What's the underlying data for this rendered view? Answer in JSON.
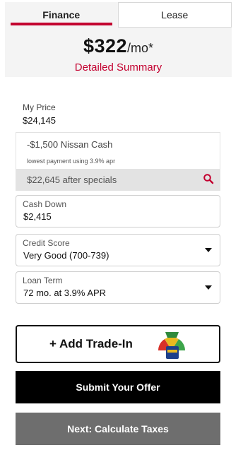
{
  "tabs": [
    {
      "label": "Finance",
      "active": true
    },
    {
      "label": "Lease",
      "active": false
    }
  ],
  "summary": {
    "payment_amount": "$322",
    "payment_unit": "/mo*",
    "link_label": "Detailed Summary"
  },
  "price": {
    "label": "My Price",
    "value": "$24,145"
  },
  "specials": {
    "name": "-$1,500 Nissan Cash",
    "note": "lowest payment using 3.9% apr",
    "after_text": "$22,645 after specials",
    "search_icon": "search-icon"
  },
  "fields": {
    "cash_down": {
      "label": "Cash Down",
      "value": "$2,415"
    },
    "credit_score": {
      "label": "Credit Score",
      "value": "Very Good (700-739)"
    },
    "loan_term": {
      "label": "Loan Term",
      "value": "72 mo. at 3.9% APR"
    }
  },
  "buttons": {
    "trade_in": "+ Add Trade-In",
    "submit": "Submit Your Offer",
    "next": "Next: Calculate Taxes"
  },
  "colors": {
    "accent": "#c3002f",
    "submit_bg": "#000000",
    "next_bg": "#6e6e6e"
  }
}
